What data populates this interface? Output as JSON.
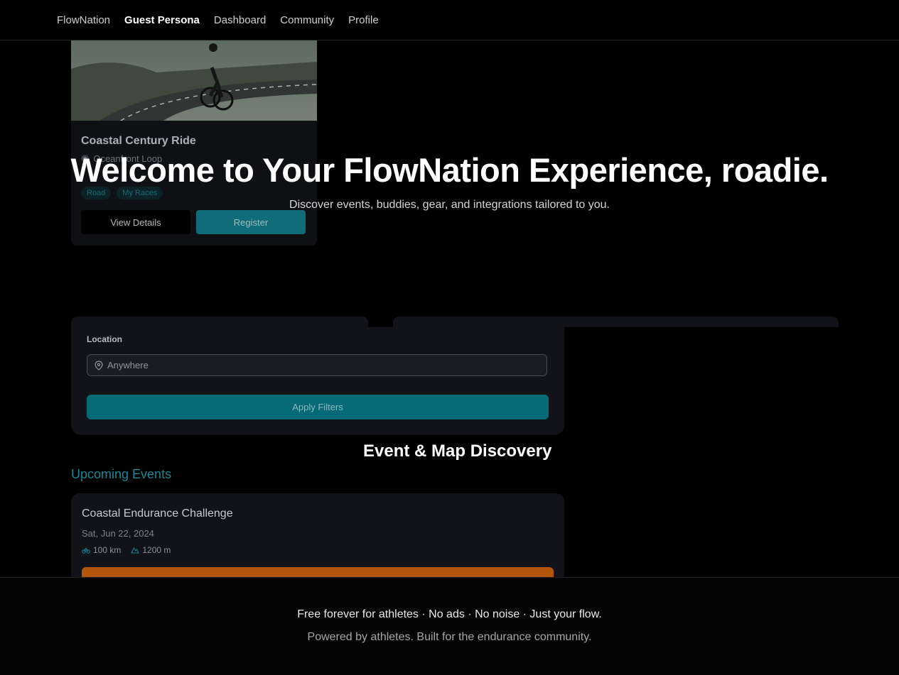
{
  "nav": {
    "items": [
      "FlowNation",
      "Guest Persona",
      "Dashboard",
      "Community",
      "Profile"
    ],
    "active": "Guest Persona"
  },
  "featured": {
    "title": "Coastal Century Ride",
    "location": "Oceanfront Loop",
    "tags": [
      "Road",
      "My Races"
    ],
    "view_label": "View Details",
    "register_label": "Register"
  },
  "hero": {
    "title": "Welcome to Your FlowNation Experience, roadie.",
    "subtitle": "Discover events, buddies, gear, and integrations tailored to you."
  },
  "filters": {
    "location_label": "Location",
    "location_placeholder": "Anywhere",
    "apply_label": "Apply Filters"
  },
  "discovery": {
    "section_title": "Event & Map Discovery",
    "upcoming_label": "Upcoming Events",
    "event": {
      "title": "Coastal Endurance Challenge",
      "date": "Sat, Jun 22, 2024",
      "distance": "100 km",
      "elevation": "1200 m"
    }
  },
  "footer": {
    "line1": "Free forever for athletes · No ads · No noise · Just your flow.",
    "line2": "Powered by athletes. Built for the endurance community."
  },
  "colors": {
    "accent": "#127f8e",
    "cta": "#b4560c"
  }
}
